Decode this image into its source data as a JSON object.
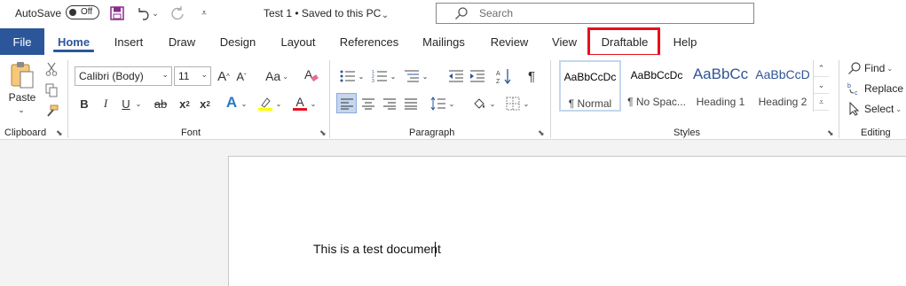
{
  "titlebar": {
    "autosave_label": "AutoSave",
    "autosave_state": "Off",
    "doc_title": "Test 1 • Saved to this PC",
    "search_placeholder": "Search",
    "quick_access_icons": [
      "save-icon",
      "undo-icon",
      "redo-icon",
      "customize-qat-icon"
    ]
  },
  "tabs": {
    "file": "File",
    "items": [
      "Home",
      "Insert",
      "Draw",
      "Design",
      "Layout",
      "References",
      "Mailings",
      "Review",
      "View",
      "Draftable",
      "Help"
    ],
    "active": "Home",
    "highlighted": "Draftable"
  },
  "ribbon": {
    "clipboard": {
      "label": "Clipboard",
      "paste": "Paste"
    },
    "font": {
      "label": "Font",
      "font_name": "Calibri (Body)",
      "font_size": "11",
      "grow": "A",
      "shrink": "A",
      "case": "Aa",
      "bold": "B",
      "italic": "I",
      "underline": "U",
      "strike": "ab",
      "subscript": "x",
      "superscript": "x",
      "text_effects": "A",
      "font_color": "A"
    },
    "paragraph": {
      "label": "Paragraph",
      "pilcrow": "¶"
    },
    "styles": {
      "label": "Styles",
      "items": [
        {
          "preview": "AaBbCcDc",
          "name": "¶ Normal"
        },
        {
          "preview": "AaBbCcDc",
          "name": "¶ No Spac..."
        },
        {
          "preview": "AaBbCc",
          "name": "Heading 1"
        },
        {
          "preview": "AaBbCcD",
          "name": "Heading 2"
        }
      ]
    },
    "editing": {
      "label": "Editing",
      "find": "Find",
      "replace": "Replace",
      "select": "Select"
    }
  },
  "document": {
    "text": "This is a test document"
  },
  "colors": {
    "accent": "#2b579a",
    "highlight_box": "#e8101a",
    "highlight_yellow": "#ffff00",
    "font_color_red": "#e81123"
  }
}
